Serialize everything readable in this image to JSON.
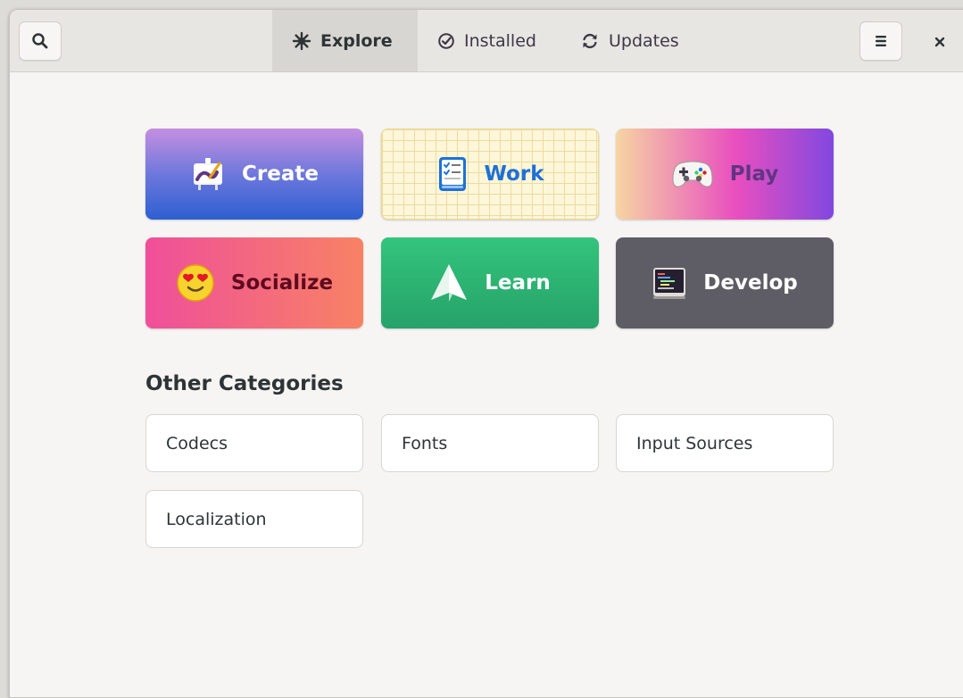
{
  "header": {
    "tabs": [
      {
        "label": "Explore",
        "icon": "explore-icon",
        "active": true
      },
      {
        "label": "Installed",
        "icon": "check-icon",
        "active": false
      },
      {
        "label": "Updates",
        "icon": "refresh-icon",
        "active": false
      }
    ]
  },
  "featured": {
    "tiles": [
      {
        "label": "Create",
        "icon": "easel-icon",
        "text_color": "#ffffff"
      },
      {
        "label": "Work",
        "icon": "checklist-icon",
        "text_color": "#1c71d8"
      },
      {
        "label": "Play",
        "icon": "gamepad-icon",
        "text_color": "#613583"
      },
      {
        "label": "Socialize",
        "icon": "heart-eyes-emoji-icon",
        "text_color": "#5e0a1f"
      },
      {
        "label": "Learn",
        "icon": "paper-plane-icon",
        "text_color": "#ffffff"
      },
      {
        "label": "Develop",
        "icon": "terminal-icon",
        "text_color": "#ffffff"
      }
    ]
  },
  "other": {
    "title": "Other Categories",
    "items": [
      {
        "label": "Codecs"
      },
      {
        "label": "Fonts"
      },
      {
        "label": "Input Sources"
      },
      {
        "label": "Localization"
      }
    ]
  },
  "colors": {
    "create_gradient": [
      "#c48fe0",
      "#2d5fd1"
    ],
    "work_bg": "#fdf6d8",
    "play_gradient": [
      "#f6d5a3",
      "#e94fbf",
      "#8148e0"
    ],
    "socialize_gradient": [
      "#ef4f9a",
      "#f88264"
    ],
    "learn_bg": "#2dbb72",
    "develop_bg": "#5e5c64"
  }
}
